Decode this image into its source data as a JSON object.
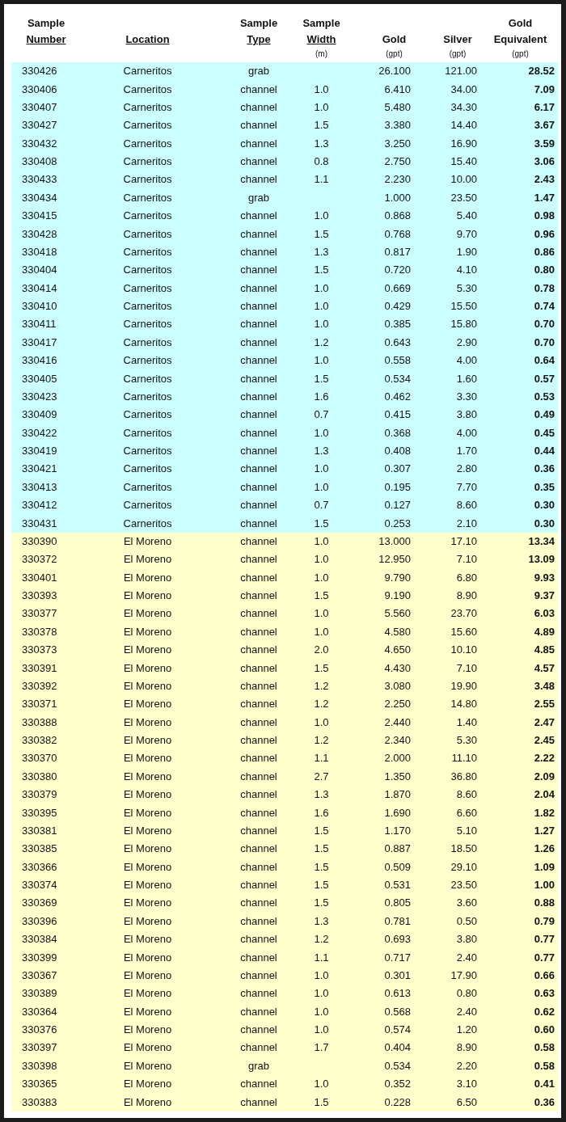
{
  "table": {
    "columns": [
      {
        "lines": [
          "Sample",
          "Number"
        ],
        "underlined": true
      },
      {
        "lines": [
          "Location"
        ],
        "underlined": true
      },
      {
        "lines": [
          "Sample",
          "Type"
        ],
        "underlined": true
      },
      {
        "lines": [
          "Sample",
          "Width"
        ],
        "underlined": true,
        "unit": "(m)"
      },
      {
        "lines": [
          "Gold"
        ],
        "underlined": false,
        "unit": "(gpt)"
      },
      {
        "lines": [
          "Silver"
        ],
        "underlined": false,
        "unit": "(gpt)"
      },
      {
        "lines": [
          "Gold",
          "Equivalent"
        ],
        "underlined": false,
        "unit": "(gpt)"
      }
    ],
    "groups": [
      {
        "color": "#ccffff",
        "rows": [
          [
            "330426",
            "Carneritos",
            "grab",
            "",
            "26.100",
            "121.00",
            "28.52"
          ],
          [
            "330406",
            "Carneritos",
            "channel",
            "1.0",
            "6.410",
            "34.00",
            "7.09"
          ],
          [
            "330407",
            "Carneritos",
            "channel",
            "1.0",
            "5.480",
            "34.30",
            "6.17"
          ],
          [
            "330427",
            "Carneritos",
            "channel",
            "1.5",
            "3.380",
            "14.40",
            "3.67"
          ],
          [
            "330432",
            "Carneritos",
            "channel",
            "1.3",
            "3.250",
            "16.90",
            "3.59"
          ],
          [
            "330408",
            "Carneritos",
            "channel",
            "0.8",
            "2.750",
            "15.40",
            "3.06"
          ],
          [
            "330433",
            "Carneritos",
            "channel",
            "1.1",
            "2.230",
            "10.00",
            "2.43"
          ],
          [
            "330434",
            "Carneritos",
            "grab",
            "",
            "1.000",
            "23.50",
            "1.47"
          ],
          [
            "330415",
            "Carneritos",
            "channel",
            "1.0",
            "0.868",
            "5.40",
            "0.98"
          ],
          [
            "330428",
            "Carneritos",
            "channel",
            "1.5",
            "0.768",
            "9.70",
            "0.96"
          ],
          [
            "330418",
            "Carneritos",
            "channel",
            "1.3",
            "0.817",
            "1.90",
            "0.86"
          ],
          [
            "330404",
            "Carneritos",
            "channel",
            "1.5",
            "0.720",
            "4.10",
            "0.80"
          ],
          [
            "330414",
            "Carneritos",
            "channel",
            "1.0",
            "0.669",
            "5.30",
            "0.78"
          ],
          [
            "330410",
            "Carneritos",
            "channel",
            "1.0",
            "0.429",
            "15.50",
            "0.74"
          ],
          [
            "330411",
            "Carneritos",
            "channel",
            "1.0",
            "0.385",
            "15.80",
            "0.70"
          ],
          [
            "330417",
            "Carneritos",
            "channel",
            "1.2",
            "0.643",
            "2.90",
            "0.70"
          ],
          [
            "330416",
            "Carneritos",
            "channel",
            "1.0",
            "0.558",
            "4.00",
            "0.64"
          ],
          [
            "330405",
            "Carneritos",
            "channel",
            "1.5",
            "0.534",
            "1.60",
            "0.57"
          ],
          [
            "330423",
            "Carneritos",
            "channel",
            "1.6",
            "0.462",
            "3.30",
            "0.53"
          ],
          [
            "330409",
            "Carneritos",
            "channel",
            "0.7",
            "0.415",
            "3.80",
            "0.49"
          ],
          [
            "330422",
            "Carneritos",
            "channel",
            "1.0",
            "0.368",
            "4.00",
            "0.45"
          ],
          [
            "330419",
            "Carneritos",
            "channel",
            "1.3",
            "0.408",
            "1.70",
            "0.44"
          ],
          [
            "330421",
            "Carneritos",
            "channel",
            "1.0",
            "0.307",
            "2.80",
            "0.36"
          ],
          [
            "330413",
            "Carneritos",
            "channel",
            "1.0",
            "0.195",
            "7.70",
            "0.35"
          ],
          [
            "330412",
            "Carneritos",
            "channel",
            "0.7",
            "0.127",
            "8.60",
            "0.30"
          ],
          [
            "330431",
            "Carneritos",
            "channel",
            "1.5",
            "0.253",
            "2.10",
            "0.30"
          ]
        ]
      },
      {
        "color": "#ffffcc",
        "rows": [
          [
            "330390",
            "El Moreno",
            "channel",
            "1.0",
            "13.000",
            "17.10",
            "13.34"
          ],
          [
            "330372",
            "El Moreno",
            "channel",
            "1.0",
            "12.950",
            "7.10",
            "13.09"
          ],
          [
            "330401",
            "El Moreno",
            "channel",
            "1.0",
            "9.790",
            "6.80",
            "9.93"
          ],
          [
            "330393",
            "El Moreno",
            "channel",
            "1.5",
            "9.190",
            "8.90",
            "9.37"
          ],
          [
            "330377",
            "El Moreno",
            "channel",
            "1.0",
            "5.560",
            "23.70",
            "6.03"
          ],
          [
            "330378",
            "El Moreno",
            "channel",
            "1.0",
            "4.580",
            "15.60",
            "4.89"
          ],
          [
            "330373",
            "El Moreno",
            "channel",
            "2.0",
            "4.650",
            "10.10",
            "4.85"
          ],
          [
            "330391",
            "El Moreno",
            "channel",
            "1.5",
            "4.430",
            "7.10",
            "4.57"
          ],
          [
            "330392",
            "El Moreno",
            "channel",
            "1.2",
            "3.080",
            "19.90",
            "3.48"
          ],
          [
            "330371",
            "El Moreno",
            "channel",
            "1.2",
            "2.250",
            "14.80",
            "2.55"
          ],
          [
            "330388",
            "El Moreno",
            "channel",
            "1.0",
            "2.440",
            "1.40",
            "2.47"
          ],
          [
            "330382",
            "El Moreno",
            "channel",
            "1.2",
            "2.340",
            "5.30",
            "2.45"
          ],
          [
            "330370",
            "El Moreno",
            "channel",
            "1.1",
            "2.000",
            "11.10",
            "2.22"
          ],
          [
            "330380",
            "El Moreno",
            "channel",
            "2.7",
            "1.350",
            "36.80",
            "2.09"
          ],
          [
            "330379",
            "El Moreno",
            "channel",
            "1.3",
            "1.870",
            "8.60",
            "2.04"
          ],
          [
            "330395",
            "El Moreno",
            "channel",
            "1.6",
            "1.690",
            "6.60",
            "1.82"
          ],
          [
            "330381",
            "El Moreno",
            "channel",
            "1.5",
            "1.170",
            "5.10",
            "1.27"
          ],
          [
            "330385",
            "El Moreno",
            "channel",
            "1.5",
            "0.887",
            "18.50",
            "1.26"
          ],
          [
            "330366",
            "El Moreno",
            "channel",
            "1.5",
            "0.509",
            "29.10",
            "1.09"
          ],
          [
            "330374",
            "El Moreno",
            "channel",
            "1.5",
            "0.531",
            "23.50",
            "1.00"
          ],
          [
            "330369",
            "El Moreno",
            "channel",
            "1.5",
            "0.805",
            "3.60",
            "0.88"
          ],
          [
            "330396",
            "El Moreno",
            "channel",
            "1.3",
            "0.781",
            "0.50",
            "0.79"
          ],
          [
            "330384",
            "El Moreno",
            "channel",
            "1.2",
            "0.693",
            "3.80",
            "0.77"
          ],
          [
            "330399",
            "El Moreno",
            "channel",
            "1.1",
            "0.717",
            "2.40",
            "0.77"
          ],
          [
            "330367",
            "El Moreno",
            "channel",
            "1.0",
            "0.301",
            "17.90",
            "0.66"
          ],
          [
            "330389",
            "El Moreno",
            "channel",
            "1.0",
            "0.613",
            "0.80",
            "0.63"
          ],
          [
            "330364",
            "El Moreno",
            "channel",
            "1.0",
            "0.568",
            "2.40",
            "0.62"
          ],
          [
            "330376",
            "El Moreno",
            "channel",
            "1.0",
            "0.574",
            "1.20",
            "0.60"
          ],
          [
            "330397",
            "El Moreno",
            "channel",
            "1.7",
            "0.404",
            "8.90",
            "0.58"
          ],
          [
            "330398",
            "El Moreno",
            "grab",
            "",
            "0.534",
            "2.20",
            "0.58"
          ],
          [
            "330365",
            "El Moreno",
            "channel",
            "1.0",
            "0.352",
            "3.10",
            "0.41"
          ],
          [
            "330383",
            "El Moreno",
            "channel",
            "1.5",
            "0.228",
            "6.50",
            "0.36"
          ]
        ]
      }
    ]
  }
}
